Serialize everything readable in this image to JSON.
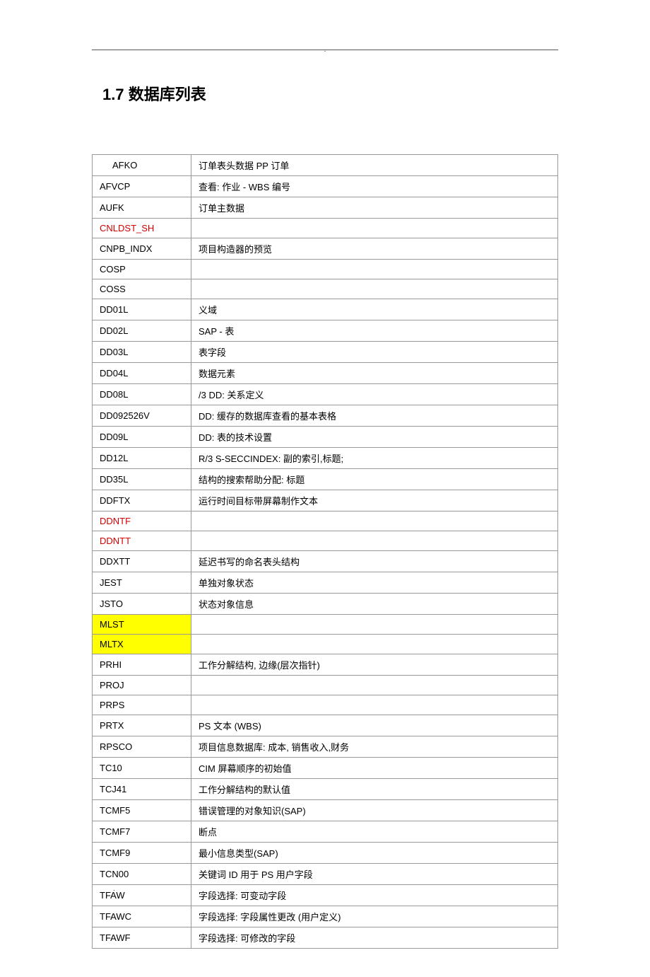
{
  "header_mark": ".",
  "footer_mark": ".",
  "section_title": "1.7 数据库列表",
  "rows": [
    {
      "code": "AFKO",
      "desc": "订单表头数据 PP 订单",
      "indent": true,
      "red": false,
      "yellow": false
    },
    {
      "code": "AFVCP",
      "desc": "查看: 作业 - WBS 编号",
      "indent": false,
      "red": false,
      "yellow": false
    },
    {
      "code": "AUFK",
      "desc": "订单主数据",
      "indent": false,
      "red": false,
      "yellow": false
    },
    {
      "code": "CNLDST_SH",
      "desc": "",
      "indent": false,
      "red": true,
      "yellow": false
    },
    {
      "code": "CNPB_INDX",
      "desc": "项目构造器的预览",
      "indent": false,
      "red": false,
      "yellow": false
    },
    {
      "code": "COSP",
      "desc": "",
      "indent": false,
      "red": false,
      "yellow": false
    },
    {
      "code": "COSS",
      "desc": "",
      "indent": false,
      "red": false,
      "yellow": false
    },
    {
      "code": "DD01L",
      "desc": "义域",
      "indent": false,
      "red": false,
      "yellow": false
    },
    {
      "code": "DD02L",
      "desc": "SAP - 表",
      "indent": false,
      "red": false,
      "yellow": false
    },
    {
      "code": "DD03L",
      "desc": "表字段",
      "indent": false,
      "red": false,
      "yellow": false
    },
    {
      "code": "DD04L",
      "desc": "数据元素",
      "indent": false,
      "red": false,
      "yellow": false
    },
    {
      "code": "DD08L",
      "desc": "/3 DD: 关系定义",
      "indent": false,
      "red": false,
      "yellow": false
    },
    {
      "code": "DD092526V",
      "desc": "DD:  缓存的数据库查看的基本表格",
      "indent": false,
      "red": false,
      "yellow": false
    },
    {
      "code": "DD09L",
      "desc": "DD: 表的技术设置",
      "indent": false,
      "red": false,
      "yellow": false
    },
    {
      "code": "DD12L",
      "desc": "R/3 S-SECCINDEX:  副的索引,标题;",
      "indent": false,
      "red": false,
      "yellow": false
    },
    {
      "code": "DD35L",
      "desc": "结构的搜索帮助分配:  标题",
      "indent": false,
      "red": false,
      "yellow": false
    },
    {
      "code": "DDFTX",
      "desc": "运行时间目标带屏幕制作文本",
      "indent": false,
      "red": false,
      "yellow": false
    },
    {
      "code": "DDNTF",
      "desc": "",
      "indent": false,
      "red": true,
      "yellow": false
    },
    {
      "code": "DDNTT",
      "desc": "",
      "indent": false,
      "red": true,
      "yellow": false
    },
    {
      "code": "DDXTT",
      "desc": "延迟书写的命名表头结构",
      "indent": false,
      "red": false,
      "yellow": false
    },
    {
      "code": "JEST",
      "desc": "单独对象状态",
      "indent": false,
      "red": false,
      "yellow": false
    },
    {
      "code": "JSTO",
      "desc": "状态对象信息",
      "indent": false,
      "red": false,
      "yellow": false
    },
    {
      "code": "MLST",
      "desc": "",
      "indent": false,
      "red": false,
      "yellow": true
    },
    {
      "code": "MLTX",
      "desc": "",
      "indent": false,
      "red": false,
      "yellow": true
    },
    {
      "code": "PRHI",
      "desc": "工作分解结构,  边缘(层次指针)",
      "indent": false,
      "red": false,
      "yellow": false
    },
    {
      "code": "PROJ",
      "desc": "",
      "indent": false,
      "red": false,
      "yellow": false
    },
    {
      "code": "PRPS",
      "desc": "",
      "indent": false,
      "red": false,
      "yellow": false
    },
    {
      "code": "PRTX",
      "desc": "PS 文本 (WBS)",
      "indent": false,
      "red": false,
      "yellow": false
    },
    {
      "code": "RPSCO",
      "desc": "项目信息数据库: 成本, 销售收入,财务",
      "indent": false,
      "red": false,
      "yellow": false
    },
    {
      "code": "TC10",
      "desc": "CIM 屏幕顺序的初始值",
      "indent": false,
      "red": false,
      "yellow": false
    },
    {
      "code": "TCJ41",
      "desc": "工作分解结构的默认值",
      "indent": false,
      "red": false,
      "yellow": false
    },
    {
      "code": "TCMF5",
      "desc": "错误管理的对象知识(SAP)",
      "indent": false,
      "red": false,
      "yellow": false
    },
    {
      "code": "TCMF7",
      "desc": "断点",
      "indent": false,
      "red": false,
      "yellow": false
    },
    {
      "code": "TCMF9",
      "desc": "最小信息类型(SAP)",
      "indent": false,
      "red": false,
      "yellow": false
    },
    {
      "code": "TCN00",
      "desc": "关键词 ID   用于 PS 用户字段",
      "indent": false,
      "red": false,
      "yellow": false
    },
    {
      "code": "TFAW",
      "desc": "字段选择: 可变动字段",
      "indent": false,
      "red": false,
      "yellow": false
    },
    {
      "code": "TFAWC",
      "desc": "字段选择:  字段属性更改 (用户定义)",
      "indent": false,
      "red": false,
      "yellow": false
    },
    {
      "code": "TFAWF",
      "desc": "字段选择: 可修改的字段",
      "indent": false,
      "red": false,
      "yellow": false
    }
  ]
}
